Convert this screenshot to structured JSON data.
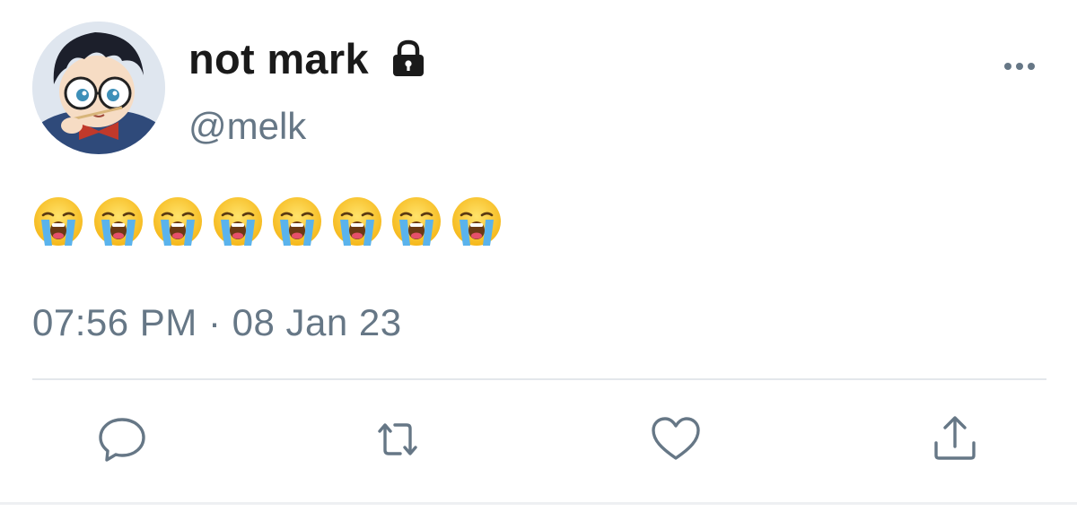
{
  "user": {
    "display_name": "not mark",
    "handle": "@melk",
    "protected_icon": "lock-icon",
    "avatar": "avatar"
  },
  "tweet": {
    "emoji_text": "😭😭😭😭😭😭😭😭",
    "emoji_icon": "loudly-crying-face-icon",
    "emoji_count": 8,
    "timestamp": "07:56 PM · 08 Jan 23"
  },
  "actions": [
    {
      "name": "reply",
      "icon": "comment-icon"
    },
    {
      "name": "retweet",
      "icon": "retweet-icon"
    },
    {
      "name": "like",
      "icon": "heart-icon"
    },
    {
      "name": "share",
      "icon": "share-icon"
    }
  ],
  "menu": {
    "icon": "more-dots-icon"
  },
  "colors": {
    "name_text": "#1a1a1a",
    "secondary_text": "#667786",
    "icon_stroke": "#667786",
    "divider": "#e3e7eb"
  }
}
